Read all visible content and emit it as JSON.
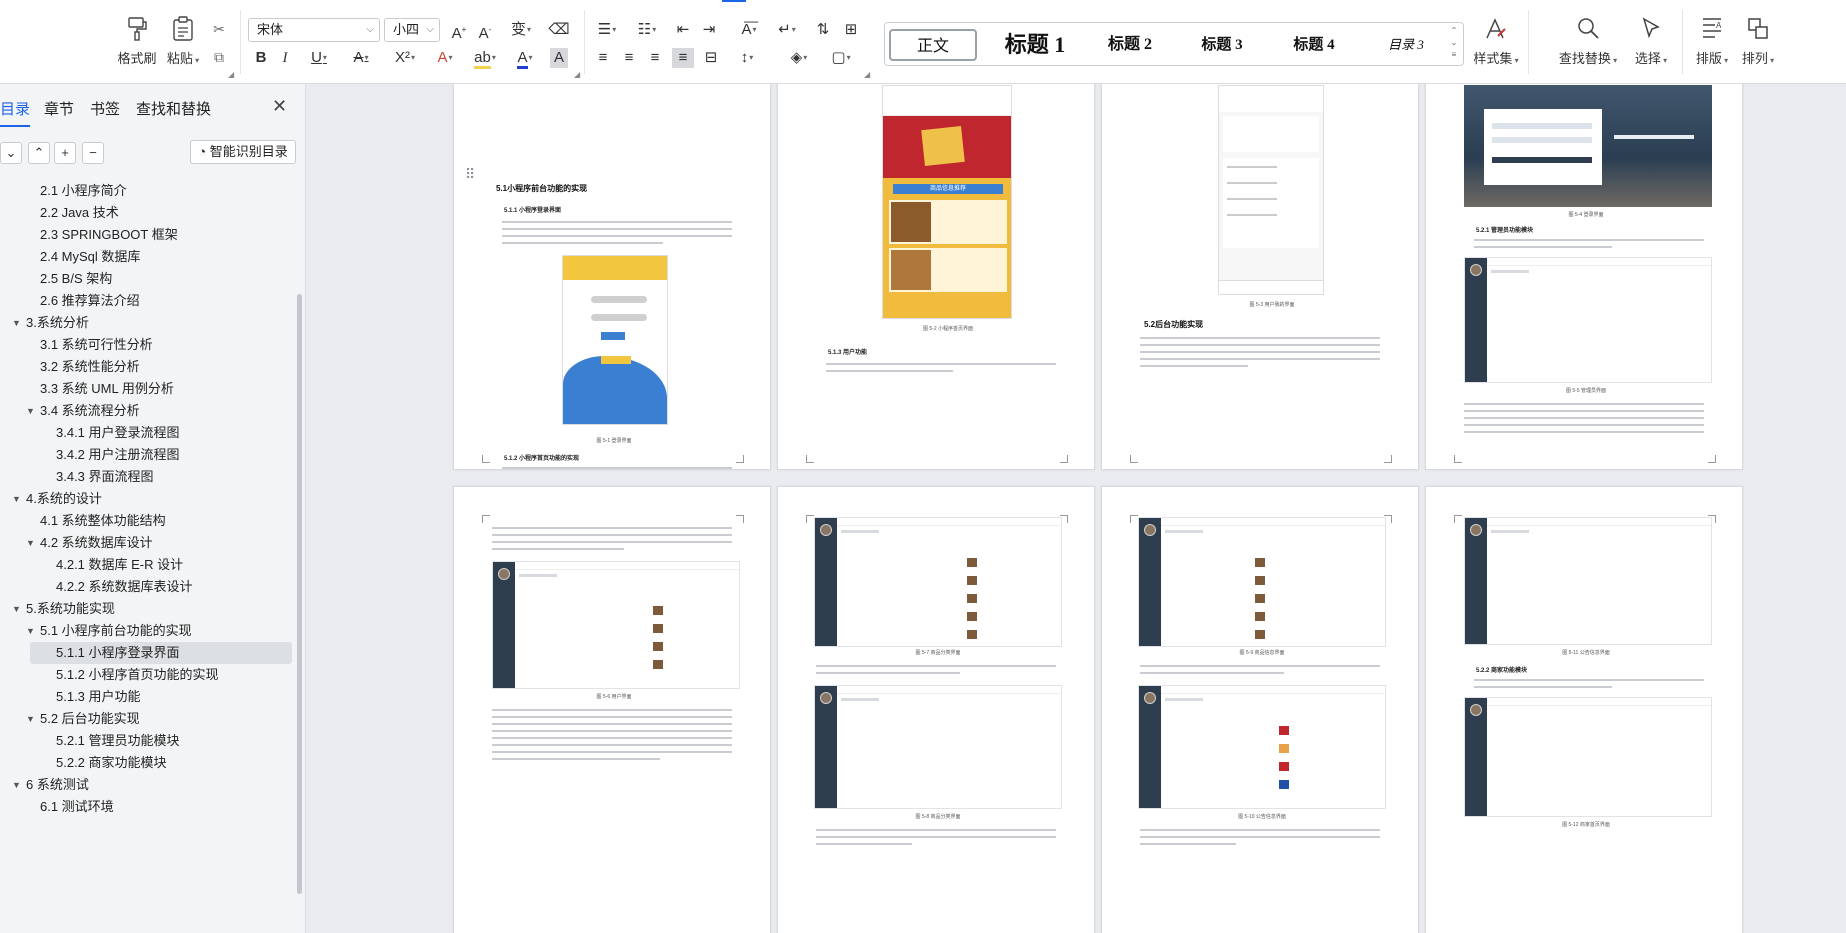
{
  "ribbon": {
    "format_painter": "格式刷",
    "paste": "粘贴",
    "font_name": "宋体",
    "font_size": "小四",
    "styles": [
      {
        "label": "正文",
        "active": true
      },
      {
        "label": "标题 1"
      },
      {
        "label": "标题 2"
      },
      {
        "label": "标题 3"
      },
      {
        "label": "标题 4"
      },
      {
        "label": "目录 3"
      }
    ],
    "style_set": "样式集",
    "find_replace": "查找替换",
    "select": "选择",
    "layout": "排版",
    "arrange": "排列"
  },
  "nav": {
    "tabs": [
      "目录",
      "章节",
      "书签",
      "查找和替换"
    ],
    "smart_toc": "智能识别目录",
    "toc": [
      {
        "label": "2.1  小程序简介",
        "level": 2
      },
      {
        "label": "2.2  Java 技术",
        "level": 2
      },
      {
        "label": "2.3  SPRINGBOOT 框架",
        "level": 2
      },
      {
        "label": "2.4  MySql 数据库",
        "level": 2
      },
      {
        "label": "2.5  B/S 架构",
        "level": 2
      },
      {
        "label": "2.6  推荐算法介绍",
        "level": 2
      },
      {
        "label": "3.系统分析",
        "level": 1,
        "expanded": true
      },
      {
        "label": "3.1  系统可行性分析",
        "level": 2
      },
      {
        "label": "3.2  系统性能分析",
        "level": 2
      },
      {
        "label": "3.3  系统 UML 用例分析",
        "level": 2
      },
      {
        "label": "3.4  系统流程分析",
        "level": 2,
        "expanded": true
      },
      {
        "label": "3.4.1  用户登录流程图",
        "level": 3
      },
      {
        "label": "3.4.2  用户注册流程图",
        "level": 3
      },
      {
        "label": "3.4.3  界面流程图",
        "level": 3
      },
      {
        "label": "4.系统的设计",
        "level": 1,
        "expanded": true
      },
      {
        "label": "4.1  系统整体功能结构",
        "level": 2
      },
      {
        "label": "4.2  系统数据库设计",
        "level": 2,
        "expanded": true
      },
      {
        "label": "4.2.1  数据库 E-R 设计",
        "level": 3
      },
      {
        "label": "4.2.2  系统数据库表设计",
        "level": 3
      },
      {
        "label": "5.系统功能实现",
        "level": 1,
        "expanded": true
      },
      {
        "label": "5.1  小程序前台功能的实现",
        "level": 2,
        "expanded": true
      },
      {
        "label": "5.1.1  小程序登录界面",
        "level": 3,
        "selected": true
      },
      {
        "label": "5.1.2  小程序首页功能的实现",
        "level": 3
      },
      {
        "label": "5.1.3  用户功能",
        "level": 3
      },
      {
        "label": "5.2  后台功能实现",
        "level": 2,
        "expanded": true
      },
      {
        "label": "5.2.1  管理员功能模块",
        "level": 3
      },
      {
        "label": "5.2.2  商家功能模块",
        "level": 3
      },
      {
        "label": "6 系统测试",
        "level": 1,
        "expanded": true
      },
      {
        "label": "6.1  测试环境",
        "level": 2
      }
    ]
  },
  "pages": {
    "p1": {
      "heading": "5.1小程序前台功能的实现",
      "sub1": "5.1.1 小程序登录界面",
      "cap1": "图 5-1 登录界面",
      "sub2": "5.1.2 小程序首页功能的实现"
    },
    "p2": {
      "cap1": "图 5-2 小程序首页界面",
      "sub1": "5.1.3 用户功能",
      "phone_banner": "商品信息推荐"
    },
    "p3": {
      "cap1": "图 5-3 用户我的界面",
      "heading": "5.2后台功能实现"
    },
    "p4": {
      "cap0": "图 5-4 登录界面",
      "sub1": "5.2.1 管理员功能模块",
      "cap1": "图 5-5 管理员界面"
    },
    "p5": {
      "cap1": "图 5-6 用户界面"
    },
    "p6": {
      "cap1": "图 5-7 商品分类界面",
      "cap2": "图 5-8 商品分类界面"
    },
    "p7": {
      "cap1": "图 5-9 商品信息界面",
      "cap2": "图 5-10 公告信息界面"
    },
    "p8": {
      "cap1": "图 5-11 公告信息界面",
      "sub1": "5.2.2 商家功能模块",
      "cap2": "图 5-12 商家首页界面"
    }
  }
}
